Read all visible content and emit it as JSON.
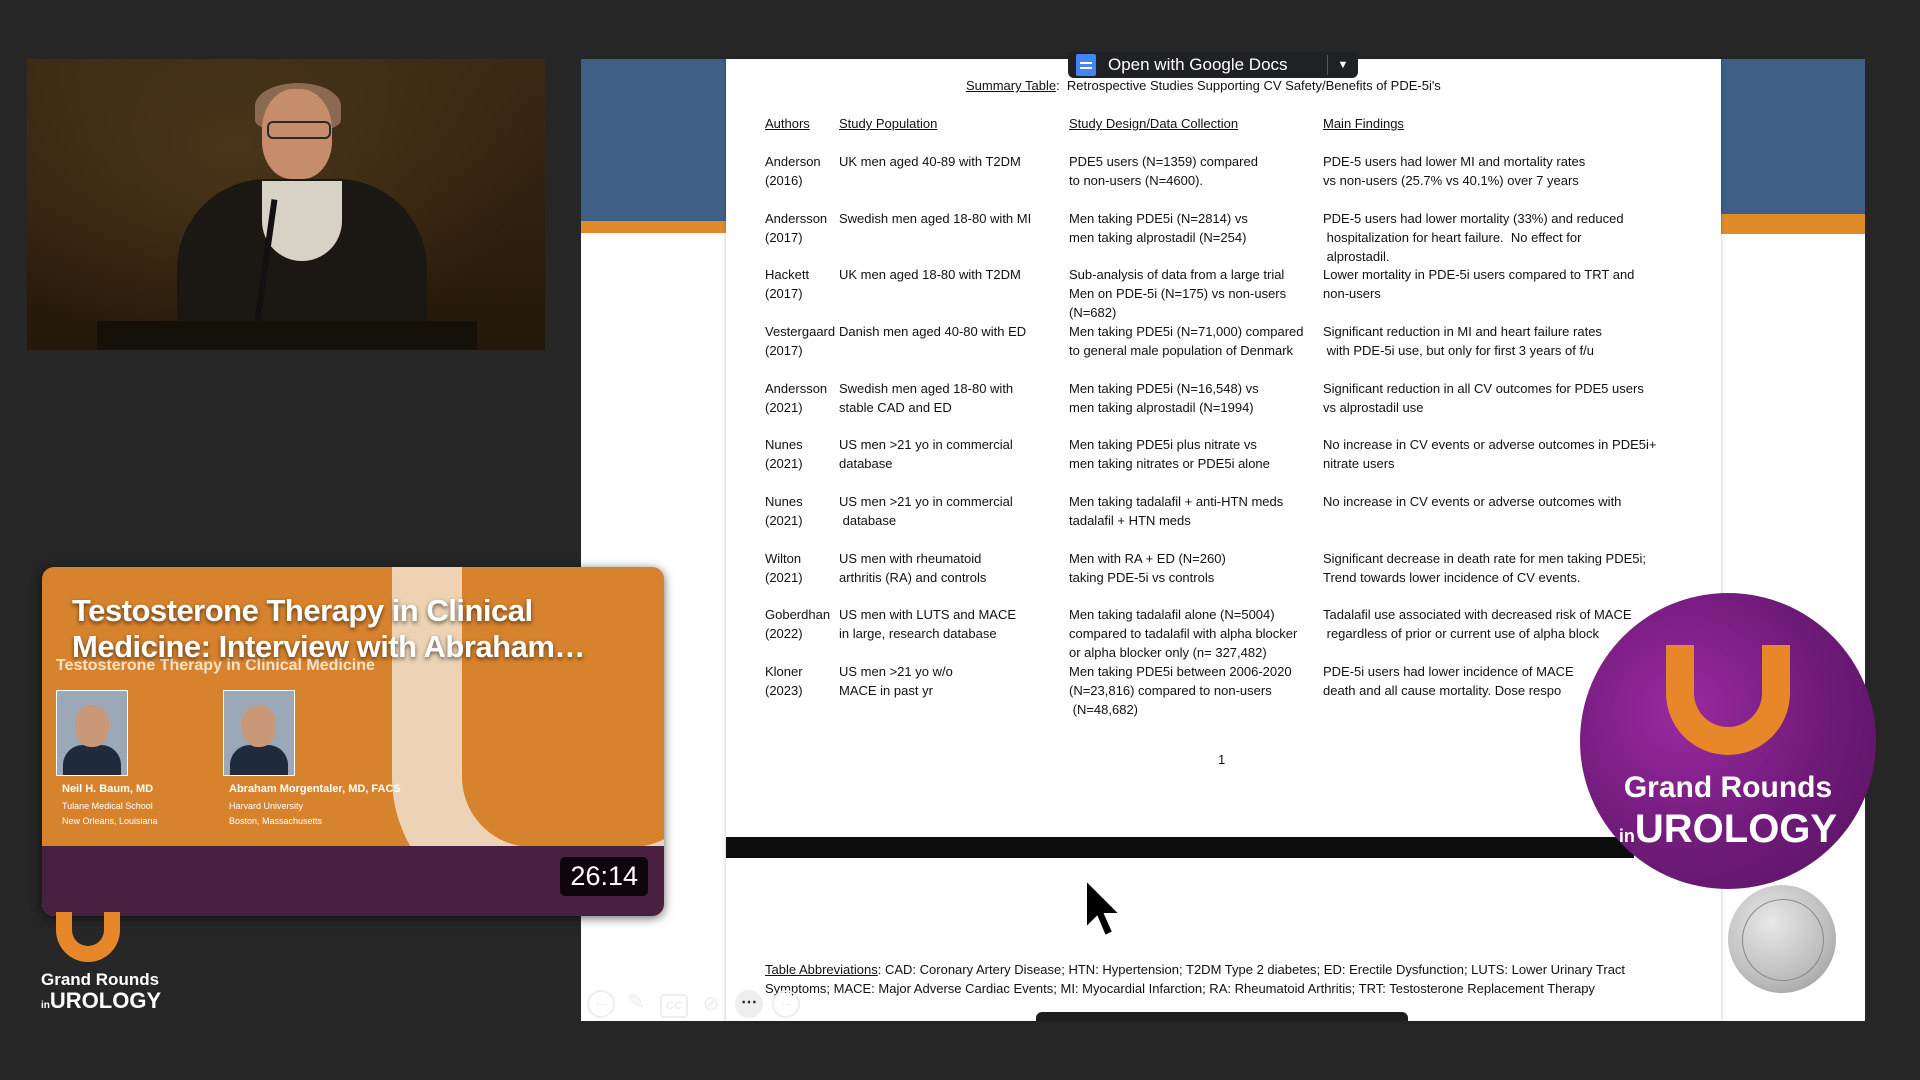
{
  "doc_toolbar": {
    "open_with": "Open with Google Docs"
  },
  "slide": {
    "caption_label": "Summary Table",
    "caption_text": "Retrospective Studies Supporting CV Safety/Benefits of PDE-5i's",
    "headers": [
      "Authors",
      "Study Population",
      "Study Design/Data Collection",
      "Main Findings"
    ],
    "rows": [
      {
        "author": [
          "Anderson",
          "(2016)"
        ],
        "population": [
          "UK men aged 40-89 with T2DM"
        ],
        "design": [
          "PDE5 users (N=1359) compared",
          "to non-users (N=4600)."
        ],
        "findings": [
          "PDE-5 users had lower MI and mortality rates",
          "vs non-users (25.7% vs 40.1%) over 7 years"
        ]
      },
      {
        "author": [
          "Andersson",
          "(2017)"
        ],
        "population": [
          "Swedish men aged 18-80 with MI"
        ],
        "design": [
          "Men taking PDE5i (N=2814) vs",
          "men taking alprostadil (N=254)"
        ],
        "findings": [
          "PDE-5 users had lower mortality (33%) and reduced",
          " hospitalization for heart failure.  No effect for",
          " alprostadil."
        ]
      },
      {
        "author": [
          "Hackett",
          "(2017)"
        ],
        "population": [
          "UK men aged 18-80 with T2DM"
        ],
        "design": [
          "Sub-analysis of data from a large trial",
          "Men on PDE-5i (N=175) vs non-users",
          "(N=682)"
        ],
        "findings": [
          "Lower mortality in PDE-5i users compared to TRT and",
          "non-users"
        ]
      },
      {
        "author": [
          "Vestergaard",
          "(2017)"
        ],
        "population": [
          "Danish men aged 40-80 with ED"
        ],
        "design": [
          "Men taking PDE5i (N=71,000) compared",
          "to general male population of Denmark"
        ],
        "findings": [
          "Significant reduction in MI and heart failure rates",
          " with PDE-5i use, but only for first 3 years of f/u"
        ]
      },
      {
        "author": [
          "Andersson",
          "(2021)"
        ],
        "population": [
          "Swedish men aged 18-80 with",
          "stable CAD and ED"
        ],
        "design": [
          "Men taking PDE5i (N=16,548) vs",
          "men taking alprostadil (N=1994)"
        ],
        "findings": [
          "Significant reduction in all CV outcomes for PDE5 users",
          "vs alprostadil use"
        ]
      },
      {
        "author": [
          "Nunes",
          "(2021)"
        ],
        "population": [
          "US men >21 yo in commercial",
          "database"
        ],
        "design": [
          "Men taking PDE5i plus nitrate vs",
          "men taking nitrates or PDE5i alone"
        ],
        "findings": [
          "No increase in CV events or adverse outcomes in PDE5i+",
          "nitrate users"
        ]
      },
      {
        "author": [
          "Nunes",
          "(2021)"
        ],
        "population": [
          "US men >21 yo in commercial",
          " database"
        ],
        "design": [
          "Men taking tadalafil + anti-HTN meds",
          "tadalafil + HTN meds"
        ],
        "findings": [
          "No increase in CV events or adverse outcomes with"
        ]
      },
      {
        "author": [
          "Wilton",
          "(2021)"
        ],
        "population": [
          "US men with rheumatoid",
          "arthritis (RA) and controls"
        ],
        "design": [
          "Men with RA + ED (N=260)",
          "taking PDE-5i vs controls"
        ],
        "findings": [
          "Significant decrease in death rate for men taking PDE5i;",
          "Trend towards lower incidence of CV events."
        ]
      },
      {
        "author": [
          "Goberdhan",
          "(2022)"
        ],
        "population": [
          "US men with LUTS and MACE",
          "in large, research database"
        ],
        "design": [
          "Men taking tadalafil alone (N=5004)",
          "compared to tadalafil with alpha blocker",
          "or alpha blocker only (n= 327,482)"
        ],
        "findings": [
          "Tadalafil use associated with decreased risk of MACE",
          " regardless of prior or current use of alpha block"
        ]
      },
      {
        "author": [
          "Kloner",
          "(2023)"
        ],
        "population": [
          "US men >21 yo w/o",
          "MACE in past yr"
        ],
        "design": [
          "Men taking PDE5i between 2006-2020",
          "(N=23,816) compared to non-users",
          " (N=48,682)"
        ],
        "findings": [
          "PDE-5i users had lower incidence of MACE",
          "death and all cause mortality. Dose respo"
        ]
      }
    ],
    "page_number": "1",
    "abbreviations_label": "Table Abbreviations",
    "abbreviations_text": ": CAD: Coronary Artery Disease; HTN: Hypertension; T2DM Type 2 diabetes; ED: Erectile Dysfunction; LUTS: Lower Urinary Tract Symptoms; MACE: Major Adverse Cardiac Events; MI: Myocardial Infarction; RA: Rheumatoid Arthritis; TRT: Testosterone Replacement Therapy"
  },
  "video_card": {
    "title": "Testosterone Therapy in Clinical Medicine: Interview with Abraham…",
    "subtitle": "Testosterone Therapy in Clinical Medicine",
    "person1": {
      "name": "Neil H. Baum, MD",
      "aff1": "Tulane Medical School",
      "aff2": "New Orleans, Louisiana"
    },
    "person2": {
      "name": "Abraham Morgentaler, MD, FACS",
      "aff1": "Harvard University",
      "aff2": "Boston, Massachusetts"
    },
    "duration": "26:14"
  },
  "logo": {
    "line1": "Grand Rounds",
    "line2_small": "in",
    "line2_big": "UROLOGY"
  },
  "toolbar_icons": [
    "back-icon",
    "pen-icon",
    "cc-icon",
    "camera-off-icon",
    "more-icon",
    "forward-icon"
  ]
}
